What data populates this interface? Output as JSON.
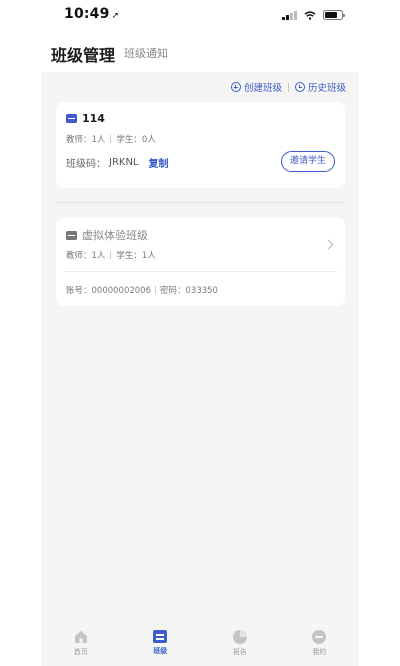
{
  "status_bar": {
    "time": "10:49",
    "location_glyph": "➚"
  },
  "header": {
    "title": "班级管理",
    "tab_notice": "班级通知"
  },
  "actions": {
    "create_class": "创建班级",
    "history_class": "历史班级"
  },
  "classes": [
    {
      "name": "114",
      "teachers_label": "教师：1人",
      "students_label": "学生：0人",
      "code_label": "班级码：",
      "code_value": "JRKNL",
      "copy_label": "复制",
      "invite_label": "邀请学生"
    },
    {
      "name": "虚拟体验班级",
      "teachers_label": "教师：1人",
      "students_label": "学生：1人",
      "account_label": "账号：00000002006",
      "password_label": "密码：033350"
    }
  ],
  "tabbar": {
    "items": [
      {
        "label": "首页",
        "icon": "home-icon"
      },
      {
        "label": "班级",
        "icon": "class-icon",
        "active": true
      },
      {
        "label": "报告",
        "icon": "report-icon"
      },
      {
        "label": "我的",
        "icon": "mine-icon"
      }
    ]
  },
  "colors": {
    "accent": "#3d5bcb",
    "background": "#f5f5f5"
  }
}
